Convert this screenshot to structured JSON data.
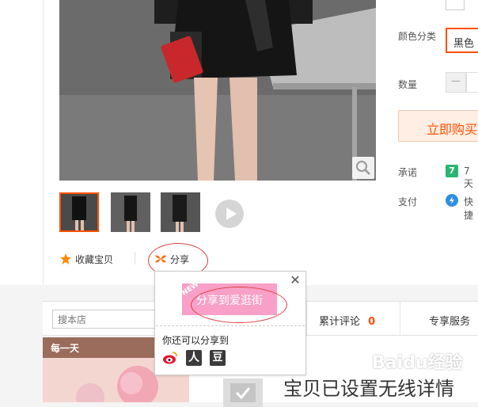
{
  "product": {
    "favorite_label": "收藏宝贝",
    "share_label": "分享"
  },
  "sku": {
    "color_label": "颜色分类",
    "color_value": "黑色",
    "quantity_label": "数量",
    "minus_symbol": "—",
    "buy_now_label": "立即购买",
    "promise_label": "承诺",
    "promise_value": "7天",
    "promise_badge": "7",
    "pay_label": "支付",
    "pay_value": "快捷"
  },
  "share_popup": {
    "close_symbol": "✕",
    "new_tag": "NEW",
    "aiguang_button": "分享到爱逛街",
    "more_label": "你还可以分享到",
    "renren_glyph": "人",
    "douban_glyph": "豆"
  },
  "store_bar": {
    "search_placeholder": "搜本店",
    "reviews_label": "累计评论",
    "reviews_count": "0",
    "service_label": "专享服务"
  },
  "daily": {
    "title": "每一天"
  },
  "wireless_notice": "宝贝已设置无线详情",
  "watermark": "Baidu经验",
  "colors": {
    "accent": "#ff5000",
    "pink_button": "#f8a0c8",
    "annotation_red": "#e04040"
  }
}
